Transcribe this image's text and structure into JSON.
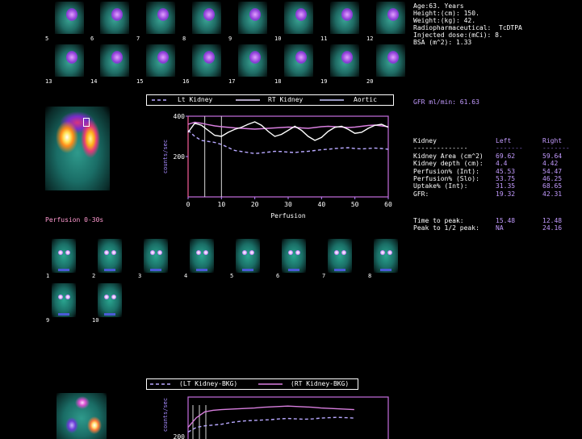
{
  "patient": {
    "age": "Age:63. Years",
    "height": "Height:(cm): 150.",
    "weight": "Weight:(kg): 42.",
    "radiopharmaceutical": "Radiopharmaceutical:  TcDTPA",
    "injected_dose": "Injected dose:(mCi): 8.",
    "bsa": "BSA (m^2): 1.33"
  },
  "frames_top": {
    "row1": [
      "5",
      "6",
      "7",
      "8",
      "9",
      "10",
      "11",
      "12"
    ],
    "row2": [
      "13",
      "14",
      "15",
      "16",
      "17",
      "18",
      "19",
      "20"
    ]
  },
  "chart1": {
    "legend": {
      "lt": "Lt Kidney",
      "rt": "RT Kidney",
      "aortic": "Aortic"
    }
  },
  "gfr_label": "GFR ml/min: 61.63",
  "kidney_table": {
    "headers": [
      "Kidney",
      "Left",
      "Right"
    ],
    "separator": "--------------",
    "rows": [
      {
        "label": "Kidney Area (cm^2)",
        "left": "69.62",
        "right": "59.64"
      },
      {
        "label": "Kidney depth (cm):",
        "left": "4.4",
        "right": "4.42"
      },
      {
        "label": "Perfusion% (Int):",
        "left": "45.53",
        "right": "54.47"
      },
      {
        "label": "Perfusion% (Slo):",
        "left": "53.75",
        "right": "46.25"
      },
      {
        "label": "Uptake% (Int):",
        "left": "31.35",
        "right": "68.65"
      },
      {
        "label": "GFR:",
        "left": "19.32",
        "right": "42.31"
      }
    ],
    "time_rows": [
      {
        "label": "Time to peak:",
        "left": "15.48",
        "right": "12.48"
      },
      {
        "label": "Peak to 1/2 peak:",
        "left": "NA",
        "right": "24.16"
      }
    ]
  },
  "perfusion_label": "Perfusion 0-30s",
  "perfusion_frames": {
    "row1": [
      "1",
      "2",
      "3",
      "4",
      "5",
      "6",
      "7",
      "8"
    ],
    "row2": [
      "9",
      "10"
    ]
  },
  "chart2": {
    "legend": {
      "lt": "(LT Kidney-BKG)",
      "rt": "(RT Kidney-BKG)"
    }
  },
  "colors": {
    "lt": "#b8a8ff",
    "rt": "#d97fe0",
    "aortic": "#ffffff",
    "axis": "#b887ff",
    "border": "#c66ee0"
  },
  "chart_data": [
    {
      "type": "line",
      "title": "",
      "xlabel": "Perfusion",
      "ylabel": "counts/sec",
      "xlim": [
        0,
        60
      ],
      "ylim": [
        0,
        400
      ],
      "xticks": [
        0,
        10,
        20,
        30,
        40,
        50,
        60
      ],
      "yticks": [
        200,
        400
      ],
      "legend": "top",
      "x": [
        0,
        2,
        4,
        6,
        8,
        10,
        12,
        14,
        16,
        18,
        20,
        22,
        24,
        26,
        28,
        30,
        32,
        34,
        36,
        38,
        40,
        42,
        44,
        46,
        48,
        50,
        52,
        54,
        56,
        58,
        60
      ],
      "series": [
        {
          "name": "Lt Kidney",
          "values": [
            330,
            300,
            280,
            275,
            270,
            260,
            245,
            230,
            225,
            220,
            215,
            218,
            222,
            226,
            225,
            222,
            220,
            224,
            226,
            230,
            234,
            236,
            240,
            242,
            244,
            240,
            238,
            240,
            242,
            240,
            236
          ]
        },
        {
          "name": "RT Kidney",
          "values": [
            360,
            370,
            365,
            358,
            352,
            348,
            345,
            342,
            340,
            338,
            336,
            338,
            340,
            342,
            344,
            346,
            345,
            342,
            340,
            344,
            348,
            350,
            348,
            346,
            344,
            346,
            350,
            354,
            356,
            352,
            348
          ]
        },
        {
          "name": "Aortic",
          "values": [
            320,
            365,
            355,
            330,
            305,
            300,
            320,
            335,
            345,
            360,
            372,
            355,
            325,
            300,
            310,
            330,
            350,
            330,
            300,
            280,
            295,
            325,
            345,
            350,
            335,
            315,
            320,
            340,
            355,
            360,
            345
          ]
        }
      ]
    },
    {
      "type": "line",
      "title": "",
      "xlabel": "",
      "ylabel": "counts/sec",
      "yticks": [
        200
      ],
      "legend": "top",
      "x": [
        0,
        1,
        2,
        3,
        4,
        5,
        6,
        7,
        8,
        9,
        10,
        11,
        12,
        13,
        14,
        15,
        16,
        17,
        18,
        19,
        20
      ],
      "series": [
        {
          "name": "(LT Kidney-BKG)",
          "values": [
            0.18,
            0.3,
            0.34,
            0.36,
            0.38,
            0.42,
            0.45,
            0.47,
            0.48,
            0.49,
            0.5,
            0.52,
            0.53,
            0.52,
            0.51,
            0.52,
            0.54,
            0.55,
            0.56,
            0.55,
            0.54
          ]
        },
        {
          "name": "(RT Kidney-BKG)",
          "values": [
            0.3,
            0.55,
            0.7,
            0.74,
            0.76,
            0.77,
            0.78,
            0.79,
            0.8,
            0.82,
            0.83,
            0.84,
            0.85,
            0.84,
            0.83,
            0.82,
            0.8,
            0.79,
            0.78,
            0.77,
            0.76
          ]
        }
      ]
    }
  ]
}
